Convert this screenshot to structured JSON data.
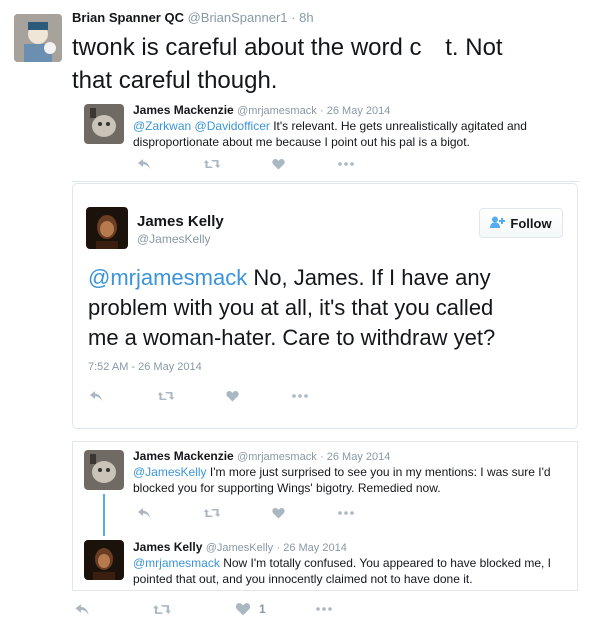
{
  "outer": {
    "author_name": "Brian Spanner QC",
    "author_handle": "@BrianSpanner1",
    "dot": "·",
    "age": "8h",
    "text_line1": "twonk is careful about the word c",
    "text_hidden": "▮▮▮",
    "text_line1b": "t. Not",
    "text_line2": "that careful though."
  },
  "quoted1": {
    "name": "James Mackenzie",
    "handle": "@mrjamesmack",
    "date": "· 26 May 2014",
    "mention1": "@Zarkwan",
    "mention2": "@Davidofficer",
    "text_rest_line1": " It's relevant. He gets unrealistically agitated and",
    "text_line2": "disproportionate about me because I point out his pal is a bigot."
  },
  "main": {
    "name": "James Kelly",
    "handle": "@JamesKelly",
    "follow_label": "Follow",
    "mention": "@mrjamesmack",
    "text_line1": " No, James.  If I have any",
    "text_line2": "problem with you at all, it's that you called",
    "text_line3": "me a woman-hater.  Care to withdraw yet?",
    "timestamp": "7:52 AM - 26 May 2014"
  },
  "reply1": {
    "name": "James Mackenzie",
    "handle": "@mrjamesmack",
    "date": "· 26 May 2014",
    "mention": "@JamesKelly",
    "text_rest_line1": " I'm more just surprised to see you in my mentions: I was sure I'd",
    "text_line2": "blocked you for supporting Wings' bigotry. Remedied now."
  },
  "reply2": {
    "name": "James Kelly",
    "handle": "@JamesKelly",
    "date": "· 26 May 2014",
    "mention": "@mrjamesmack",
    "text_rest_line1": " Now I'm totally confused.  You appeared to have blocked me, I",
    "text_line2": "pointed that out, and you innocently claimed not to have done it."
  },
  "outer_actions": {
    "like_count": "1"
  },
  "colors": {
    "link": "#3b94d9",
    "muted": "#8899a6",
    "follow_icon": "#55acee",
    "thread_line": "#55acee"
  }
}
